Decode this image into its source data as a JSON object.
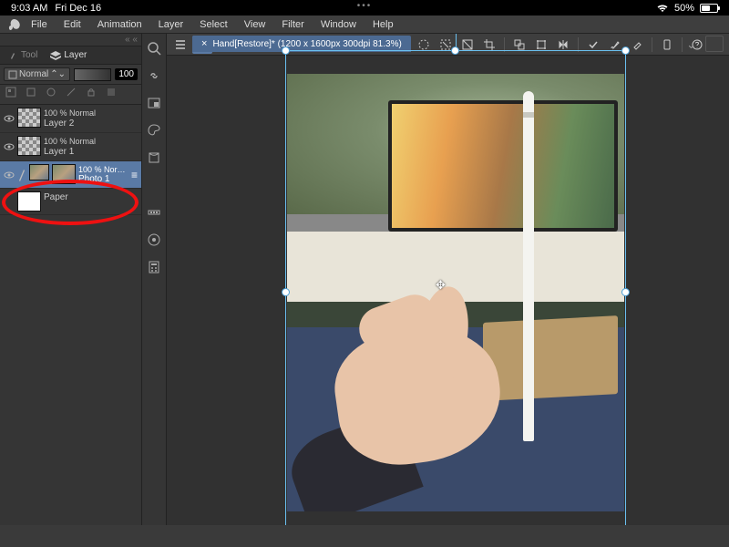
{
  "status": {
    "time": "9:03 AM",
    "date": "Fri Dec 16",
    "battery": "50%"
  },
  "menu": {
    "items": [
      "File",
      "Edit",
      "Animation",
      "Layer",
      "Select",
      "View",
      "Filter",
      "Window",
      "Help"
    ]
  },
  "panel": {
    "tabs": {
      "tool": "Tool",
      "layer": "Layer"
    },
    "blend_mode": "Normal",
    "opacity": "100"
  },
  "layers": [
    {
      "info": "100 % Normal",
      "name": "Layer 2",
      "thumb": "checker",
      "eye": true,
      "selected": false,
      "indent": false
    },
    {
      "info": "100 % Normal",
      "name": "Layer 1",
      "thumb": "checker",
      "eye": true,
      "selected": false,
      "indent": false
    },
    {
      "info": "100 % Nor…",
      "name": "Photo 1",
      "thumb": "photo",
      "eye": true,
      "selected": true,
      "indent": true
    },
    {
      "info": "",
      "name": "Paper",
      "thumb": "white",
      "eye": false,
      "selected": false,
      "indent": false
    }
  ],
  "document": {
    "tab_label": "Hand[Restore]* (1200 x 1600px 300dpi 81.3%)"
  },
  "annotation": {
    "type": "ellipse",
    "color": "#e11"
  }
}
